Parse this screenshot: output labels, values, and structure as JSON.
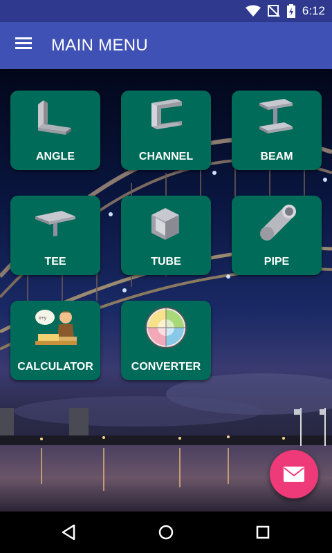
{
  "status": {
    "time": "6:12"
  },
  "app_bar": {
    "title": "MAIN MENU"
  },
  "menu": {
    "angle": "ANGLE",
    "channel": "CHANNEL",
    "beam": "BEAM",
    "tee": "TEE",
    "tube": "TUBE",
    "pipe": "PIPE",
    "calculator": "CALCULATOR",
    "converter": "CONVERTER"
  },
  "colors": {
    "status_bar": "#2f3a8f",
    "app_bar": "#3f51b5",
    "tile": "#006b58",
    "fab": "#ee3a78"
  },
  "icons": {
    "status": [
      "wifi-icon",
      "no-signal-icon",
      "battery-charging-icon"
    ],
    "app_bar": "hamburger-menu-icon",
    "fab": "mail-icon",
    "nav": [
      "back-icon",
      "home-icon",
      "recents-icon"
    ]
  }
}
